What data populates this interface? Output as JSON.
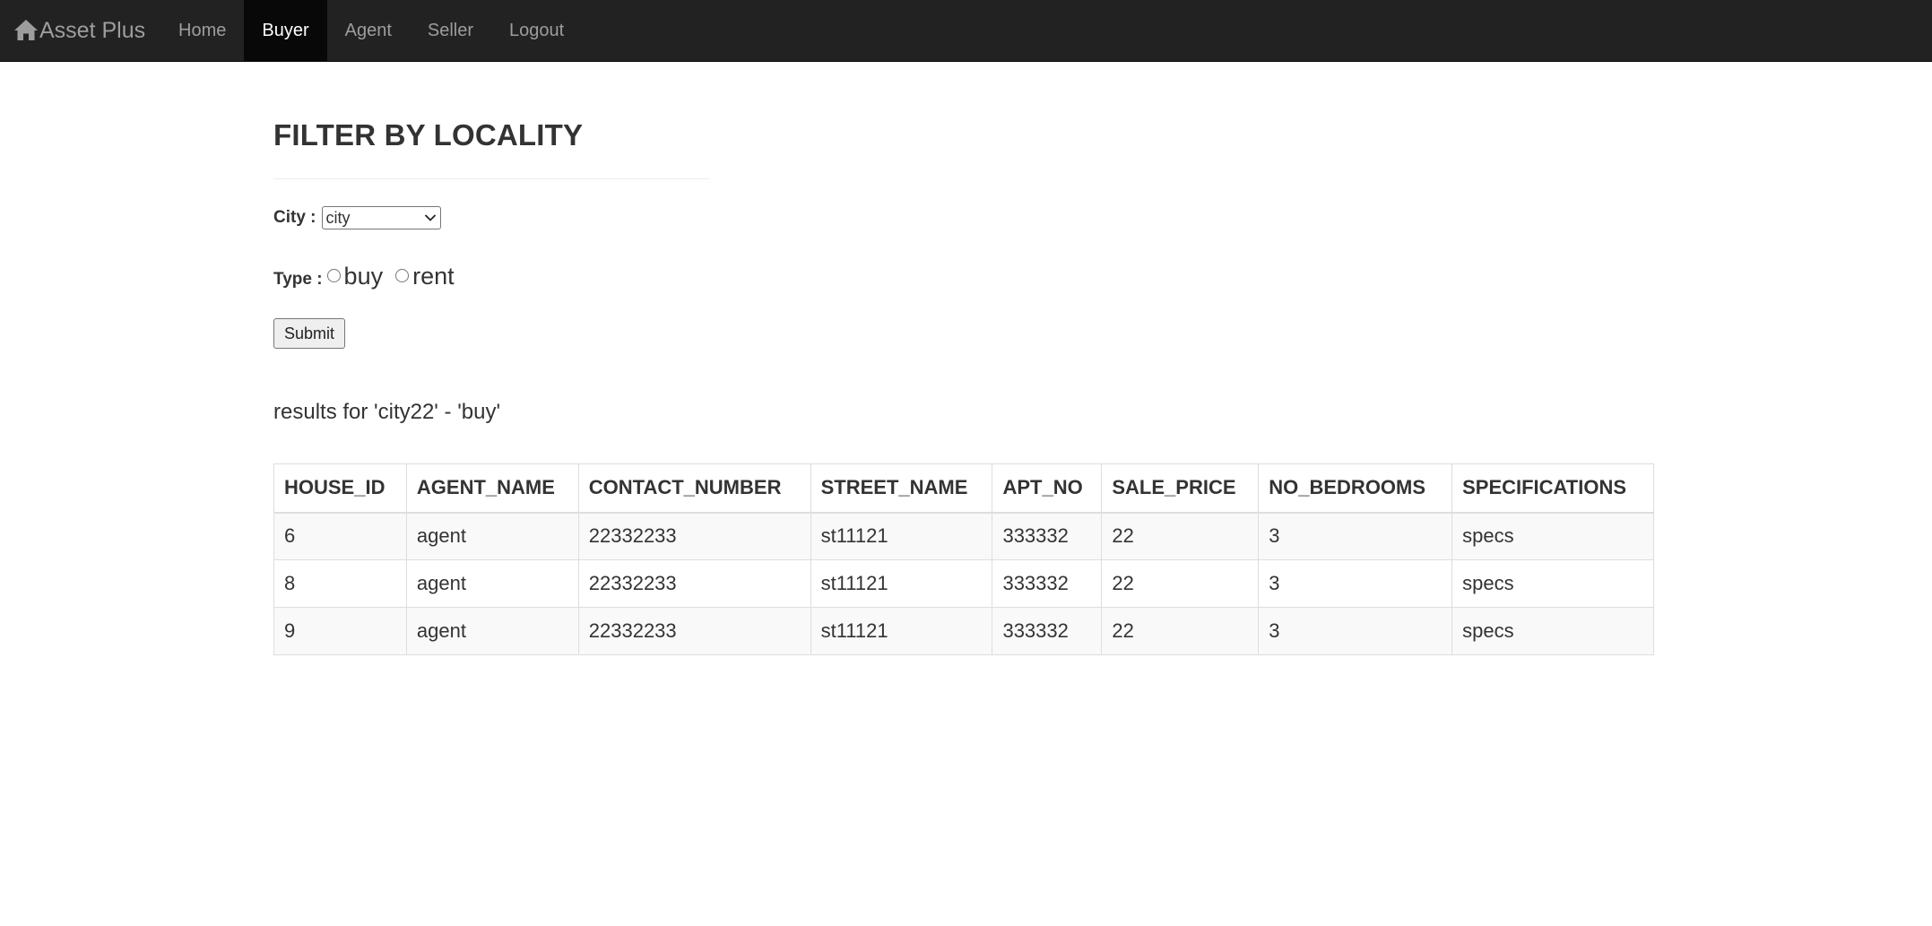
{
  "navbar": {
    "brand": "Asset Plus",
    "brand_icon": "home-icon",
    "items": [
      {
        "label": "Home",
        "active": false
      },
      {
        "label": "Buyer",
        "active": true
      },
      {
        "label": "Agent",
        "active": false
      },
      {
        "label": "Seller",
        "active": false
      },
      {
        "label": "Logout",
        "active": false
      }
    ],
    "colors": {
      "background": "#222222",
      "text": "#9d9d9d",
      "active_background": "#080808",
      "active_text": "#ffffff"
    }
  },
  "page": {
    "title": "FILTER BY LOCALITY",
    "form": {
      "city_label": "City :",
      "city_selected": "city",
      "type_label": "Type :",
      "type_options": [
        "buy",
        "rent"
      ],
      "submit_label": "Submit"
    },
    "results_text": "results for 'city22' - 'buy'"
  },
  "table": {
    "headers": [
      "HOUSE_ID",
      "AGENT_NAME",
      "CONTACT_NUMBER",
      "STREET_NAME",
      "APT_NO",
      "SALE_PRICE",
      "NO_BEDROOMS",
      "SPECIFICATIONS"
    ],
    "rows": [
      [
        "6",
        "agent",
        "22332233",
        "st11121",
        "333332",
        "22",
        "3",
        "specs"
      ],
      [
        "8",
        "agent",
        "22332233",
        "st11121",
        "333332",
        "22",
        "3",
        "specs"
      ],
      [
        "9",
        "agent",
        "22332233",
        "st11121",
        "333332",
        "22",
        "3",
        "specs"
      ]
    ]
  }
}
